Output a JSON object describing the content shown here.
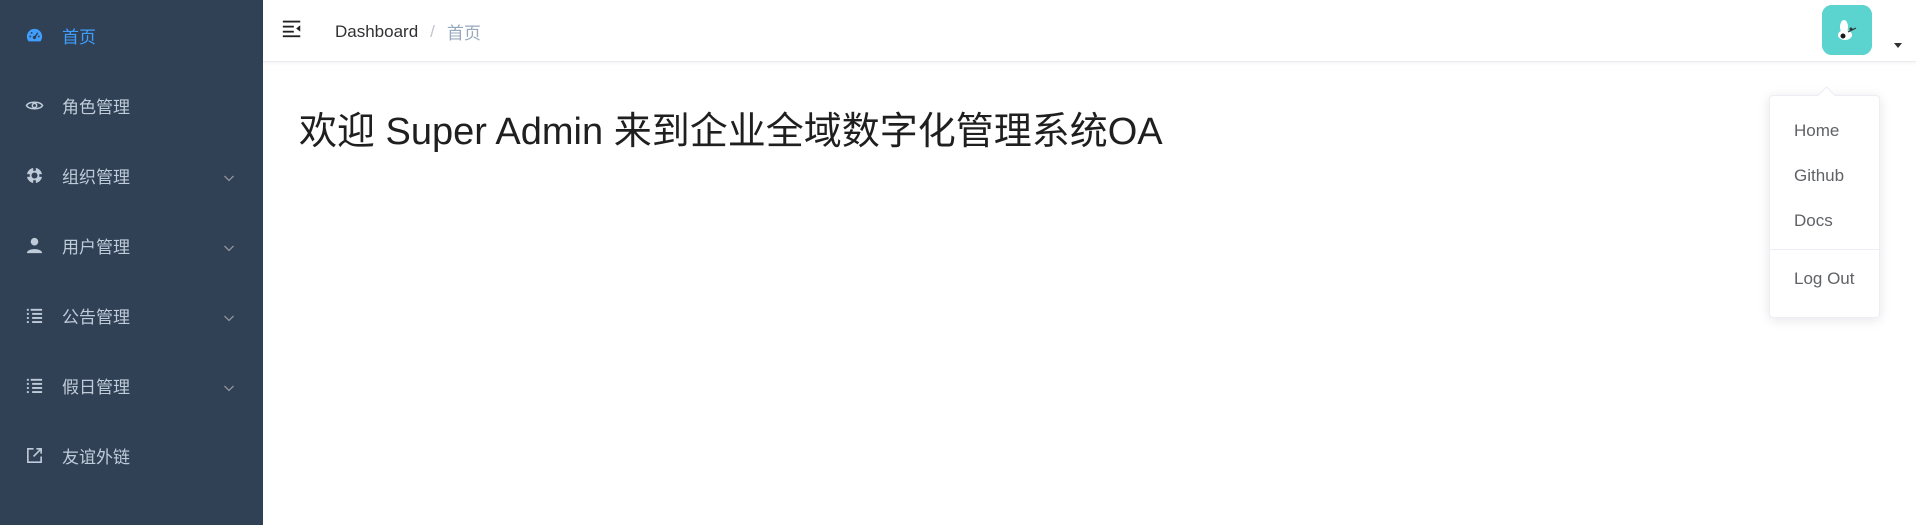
{
  "sidebar": {
    "items": [
      {
        "label": "首页",
        "icon": "dashboard-icon",
        "active": true
      },
      {
        "label": "角色管理",
        "icon": "eye-icon"
      },
      {
        "label": "组织管理",
        "icon": "lifebuoy-icon",
        "expandable": true
      },
      {
        "label": "用户管理",
        "icon": "user-icon",
        "expandable": true
      },
      {
        "label": "公告管理",
        "icon": "list-icon",
        "expandable": true
      },
      {
        "label": "假日管理",
        "icon": "list-icon",
        "expandable": true
      },
      {
        "label": "友谊外链",
        "icon": "external-link-icon"
      }
    ]
  },
  "header": {
    "breadcrumb": {
      "link": "Dashboard",
      "separator": "/",
      "current": "首页"
    }
  },
  "user_menu": {
    "items": [
      "Home",
      "Github",
      "Docs"
    ],
    "logout": "Log Out"
  },
  "main": {
    "welcome": "欢迎 Super Admin 来到企业全域数字化管理系统OA"
  },
  "colors": {
    "sidebar_bg": "#304156",
    "sidebar_text": "#bfcbd9",
    "active": "#409eff",
    "avatar_bg": "#5bd3cf"
  }
}
